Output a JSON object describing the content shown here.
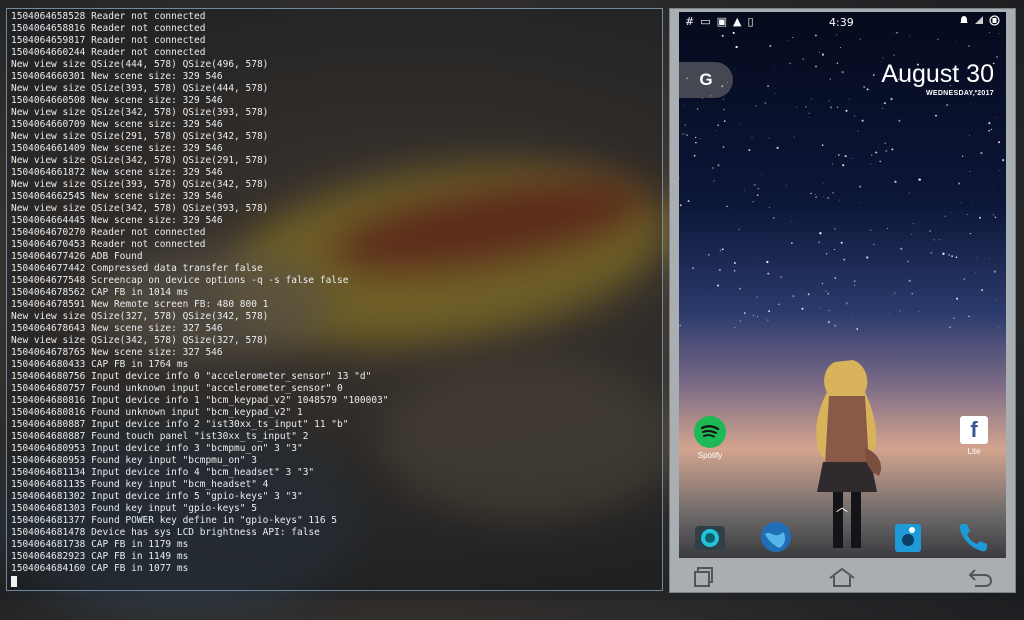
{
  "terminal": {
    "lines": [
      "1504064658528 Reader not connected",
      "1504064658816 Reader not connected",
      "1504064659817 Reader not connected",
      "1504064660244 Reader not connected",
      "New view size QSize(444, 578) QSize(496, 578)",
      "1504064660301 New scene size: 329 546",
      "New view size QSize(393, 578) QSize(444, 578)",
      "1504064660508 New scene size: 329 546",
      "New view size QSize(342, 578) QSize(393, 578)",
      "1504064660709 New scene size: 329 546",
      "New view size QSize(291, 578) QSize(342, 578)",
      "1504064661409 New scene size: 329 546",
      "New view size QSize(342, 578) QSize(291, 578)",
      "1504064661872 New scene size: 329 546",
      "New view size QSize(393, 578) QSize(342, 578)",
      "1504064662545 New scene size: 329 546",
      "New view size QSize(342, 578) QSize(393, 578)",
      "1504064664445 New scene size: 329 546",
      "1504064670270 Reader not connected",
      "1504064670453 Reader not connected",
      "1504064677426 ADB Found",
      "1504064677442 Compressed data transfer false",
      "1504064677548 Screencap on device options -q -s false false",
      "1504064678562 CAP FB in 1014 ms",
      "1504064678591 New Remote screen FB: 480 800 1",
      "New view size QSize(327, 578) QSize(342, 578)",
      "1504064678643 New scene size: 327 546",
      "New view size QSize(342, 578) QSize(327, 578)",
      "1504064678765 New scene size: 327 546",
      "1504064680433 CAP FB in 1764 ms",
      "1504064680756 Input device info 0 \"accelerometer_sensor\" 13 \"d\"",
      "1504064680757 Found unknown input \"accelerometer_sensor\" 0",
      "1504064680816 Input device info 1 \"bcm_keypad_v2\" 1048579 \"100003\"",
      "1504064680816 Found unknown input \"bcm_keypad_v2\" 1",
      "1504064680887 Input device info 2 \"ist30xx_ts_input\" 11 \"b\"",
      "1504064680887 Found touch panel \"ist30xx_ts_input\" 2",
      "1504064680953 Input device info 3 \"bcmpmu_on\" 3 \"3\"",
      "1504064680953 Found key input \"bcmpmu_on\" 3",
      "1504064681134 Input device info 4 \"bcm_headset\" 3 \"3\"",
      "1504064681135 Found key input \"bcm_headset\" 4",
      "1504064681302 Input device info 5 \"gpio-keys\" 3 \"3\"",
      "1504064681303 Found key input \"gpio-keys\" 5",
      "1504064681377 Found POWER key define in \"gpio-keys\" 116 5",
      "1504064681478 Device has sys LCD brightness API: false",
      "1504064681738 CAP FB in 1179 ms",
      "1504064682923 CAP FB in 1149 ms",
      "1504064684160 CAP FB in 1077 ms"
    ]
  },
  "phone": {
    "status": {
      "left_icons": [
        "#",
        "▭",
        "▣",
        "▲",
        "▯"
      ],
      "time": "4:39",
      "right_icons": [
        "alarm-icon",
        "signal-icon",
        "battery-icon"
      ]
    },
    "google_search": "G",
    "clock": {
      "date": "August 30",
      "day": "WEDNESDAY, 2017"
    },
    "apps": [
      {
        "label": "Spotify"
      },
      {
        "label": "Lite"
      }
    ],
    "dock": [
      "camera-icon",
      "browser-icon",
      "store-icon",
      "phone-icon"
    ],
    "nav": [
      "recent-apps-icon",
      "home-icon",
      "back-icon"
    ],
    "colors": {
      "spotify": "#1db954",
      "facebook": "#3b5998",
      "phone": "#1e9bd7"
    }
  }
}
